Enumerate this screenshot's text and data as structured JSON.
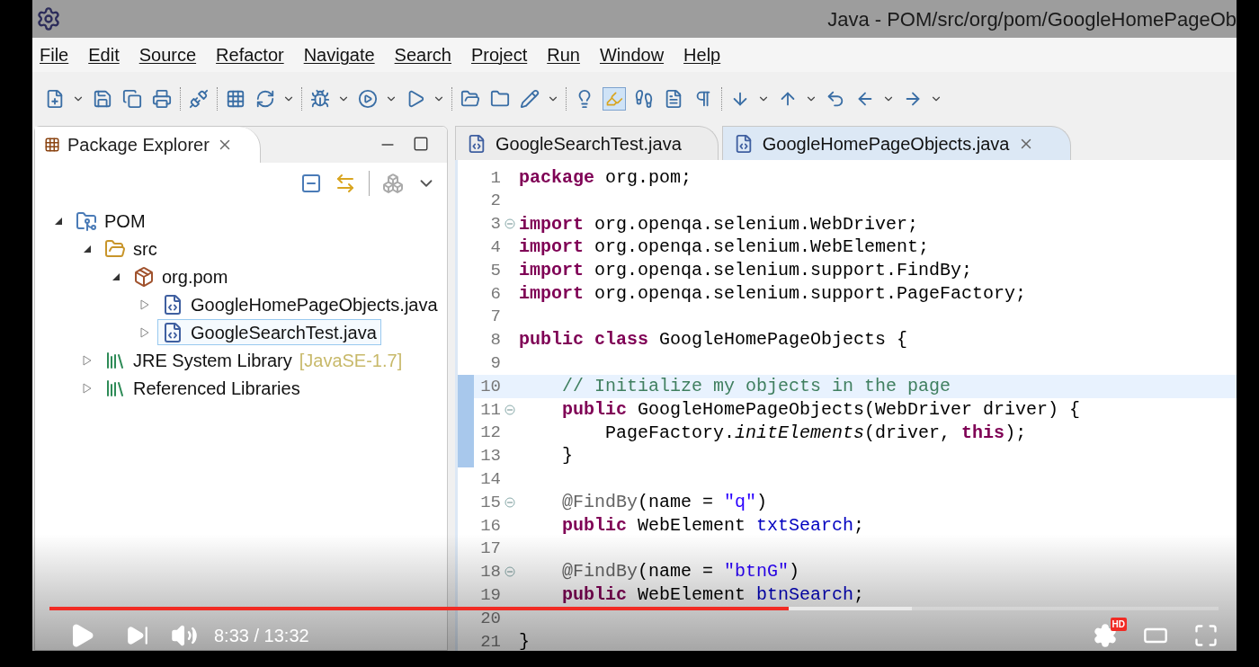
{
  "window": {
    "title": "Java - POM/src/org/pom/GoogleHomePageOb"
  },
  "menu": [
    "File",
    "Edit",
    "Source",
    "Refactor",
    "Navigate",
    "Search",
    "Project",
    "Run",
    "Window",
    "Help"
  ],
  "explorer": {
    "title": "Package Explorer",
    "tree": [
      {
        "label": "POM",
        "kind": "project",
        "expanded": true,
        "selected": false,
        "children": [
          {
            "label": "src",
            "kind": "source-folder",
            "expanded": true,
            "selected": false,
            "children": [
              {
                "label": "org.pom",
                "kind": "package",
                "expanded": true,
                "selected": false,
                "children": [
                  {
                    "label": "GoogleHomePageObjects.java",
                    "kind": "java-file",
                    "expanded": false,
                    "selected": false
                  },
                  {
                    "label": "GoogleSearchTest.java",
                    "kind": "java-file",
                    "expanded": false,
                    "selected": true
                  }
                ]
              }
            ]
          },
          {
            "label": "JRE System Library",
            "decoration": "[JavaSE-1.7]",
            "kind": "library",
            "expanded": false,
            "selected": false
          },
          {
            "label": "Referenced Libraries",
            "kind": "library",
            "expanded": false,
            "selected": false
          }
        ]
      }
    ]
  },
  "editor": {
    "tabs": [
      {
        "label": "GoogleSearchTest.java",
        "selected": false
      },
      {
        "label": "GoogleHomePageObjects.java",
        "selected": true
      }
    ],
    "lines": [
      {
        "number": "1",
        "fold": false,
        "changed": false,
        "current": false,
        "tokens": [
          {
            "text": "package",
            "kind": "keyword"
          },
          {
            "text": " org.pom;",
            "kind": "plain"
          }
        ]
      },
      {
        "number": "2",
        "fold": false,
        "changed": false,
        "current": false
      },
      {
        "number": "3",
        "fold": true,
        "changed": false,
        "current": false,
        "tokens": [
          {
            "text": "import",
            "kind": "keyword"
          },
          {
            "text": " org.openqa.selenium.WebDriver;",
            "kind": "plain"
          }
        ]
      },
      {
        "number": "4",
        "fold": false,
        "changed": false,
        "current": false,
        "tokens": [
          {
            "text": "import",
            "kind": "keyword"
          },
          {
            "text": " org.openqa.selenium.WebElement;",
            "kind": "plain"
          }
        ]
      },
      {
        "number": "5",
        "fold": false,
        "changed": false,
        "current": false,
        "tokens": [
          {
            "text": "import",
            "kind": "keyword"
          },
          {
            "text": " org.openqa.selenium.support.FindBy;",
            "kind": "plain"
          }
        ]
      },
      {
        "number": "6",
        "fold": false,
        "changed": false,
        "current": false,
        "tokens": [
          {
            "text": "import",
            "kind": "keyword"
          },
          {
            "text": " org.openqa.selenium.support.PageFactory;",
            "kind": "plain"
          }
        ]
      },
      {
        "number": "7",
        "fold": false,
        "changed": false,
        "current": false
      },
      {
        "number": "8",
        "fold": false,
        "changed": false,
        "current": false,
        "tokens": [
          {
            "text": "public class",
            "kind": "keyword"
          },
          {
            "text": " GoogleHomePageObjects {",
            "kind": "plain"
          }
        ]
      },
      {
        "number": "9",
        "fold": false,
        "changed": false,
        "current": false
      },
      {
        "number": "10",
        "fold": false,
        "changed": true,
        "current": true,
        "tokens": [
          {
            "text": "    // Initialize my objects in the page",
            "kind": "comment"
          }
        ]
      },
      {
        "number": "11",
        "fold": true,
        "changed": true,
        "current": false,
        "tokens": [
          {
            "text": "    public",
            "kind": "keyword"
          },
          {
            "text": " GoogleHomePageObjects(WebDriver driver) {",
            "kind": "plain"
          }
        ]
      },
      {
        "number": "12",
        "fold": false,
        "changed": true,
        "current": false,
        "tokens": [
          {
            "text": "        PageFactory.",
            "kind": "plain"
          },
          {
            "text": "initElements",
            "kind": "italic"
          },
          {
            "text": "(driver, ",
            "kind": "plain"
          },
          {
            "text": "this",
            "kind": "keyword"
          },
          {
            "text": ");",
            "kind": "plain"
          }
        ]
      },
      {
        "number": "13",
        "fold": false,
        "changed": true,
        "current": false,
        "tokens": [
          {
            "text": "    }",
            "kind": "plain"
          }
        ]
      },
      {
        "number": "14",
        "fold": false,
        "changed": false,
        "current": false
      },
      {
        "number": "15",
        "fold": true,
        "changed": false,
        "current": false,
        "tokens": [
          {
            "text": "    @FindBy",
            "kind": "annotation"
          },
          {
            "text": "(name = ",
            "kind": "plain"
          },
          {
            "text": "\"q\"",
            "kind": "string"
          },
          {
            "text": ")",
            "kind": "plain"
          }
        ]
      },
      {
        "number": "16",
        "fold": false,
        "changed": false,
        "current": false,
        "tokens": [
          {
            "text": "    public",
            "kind": "keyword"
          },
          {
            "text": " WebElement ",
            "kind": "plain"
          },
          {
            "text": "txtSearch",
            "kind": "field"
          },
          {
            "text": ";",
            "kind": "plain"
          }
        ]
      },
      {
        "number": "17",
        "fold": false,
        "changed": false,
        "current": false
      },
      {
        "number": "18",
        "fold": true,
        "changed": false,
        "current": false,
        "tokens": [
          {
            "text": "    @FindBy",
            "kind": "annotation"
          },
          {
            "text": "(name = ",
            "kind": "plain"
          },
          {
            "text": "\"btnG\"",
            "kind": "string"
          },
          {
            "text": ")",
            "kind": "plain"
          }
        ]
      },
      {
        "number": "19",
        "fold": false,
        "changed": false,
        "current": false,
        "tokens": [
          {
            "text": "    public",
            "kind": "keyword"
          },
          {
            "text": " WebElement ",
            "kind": "plain"
          },
          {
            "text": "btnSearch",
            "kind": "field"
          },
          {
            "text": ";",
            "kind": "plain"
          }
        ]
      },
      {
        "number": "20",
        "fold": false,
        "changed": false,
        "current": false
      },
      {
        "number": "21",
        "fold": false,
        "changed": false,
        "current": false,
        "tokens": [
          {
            "text": "}",
            "kind": "plain"
          }
        ]
      }
    ]
  },
  "player": {
    "time": "8:33 / 13:32",
    "progress": {
      "level": 0.632
    },
    "buffer": {
      "level": 0.738
    },
    "hd_badge": "HD"
  }
}
